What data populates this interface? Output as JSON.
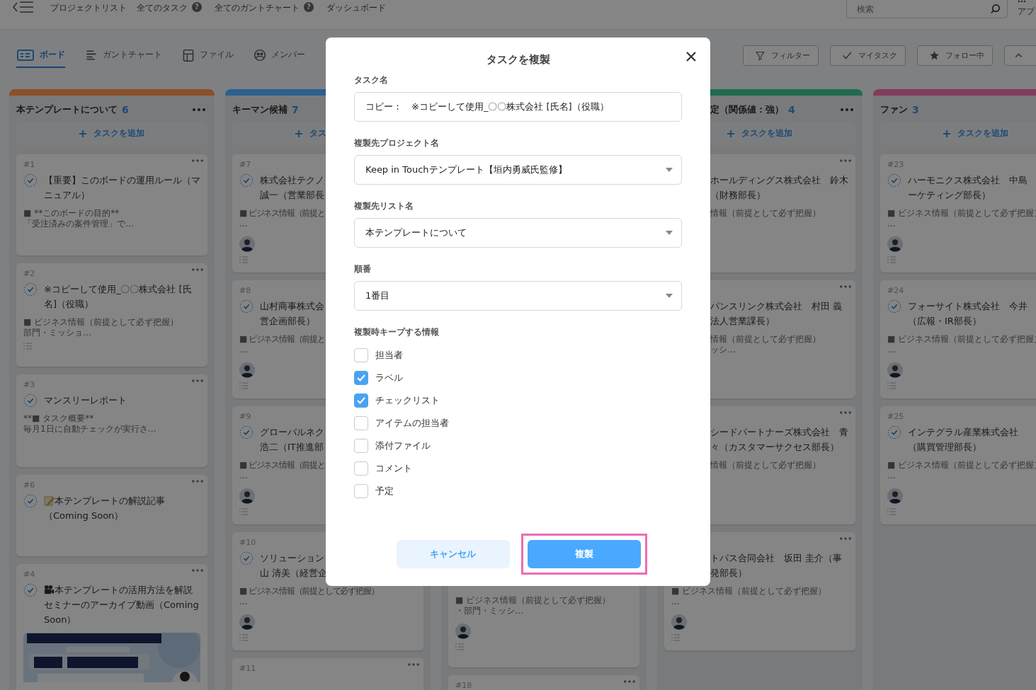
{
  "nav": {
    "items": [
      {
        "label": "プロジェクトリスト"
      },
      {
        "label": "全てのタスク",
        "help": "?"
      },
      {
        "label": "全てのガントチャート",
        "help": "?"
      },
      {
        "label": "ダッシュボード"
      }
    ],
    "search": {
      "placeholder": "検索"
    },
    "apps_label": "アプ"
  },
  "view_tabs": [
    {
      "label": "ボード",
      "selected": true
    },
    {
      "label": "ガントチャート",
      "selected": false
    },
    {
      "label": "ファイル",
      "selected": false
    },
    {
      "label": "メンバー",
      "selected": false
    }
  ],
  "toolbar_buttons": [
    {
      "label": "フィルター"
    },
    {
      "label": "マイタスク"
    },
    {
      "label": "フォロー中"
    },
    {
      "kind": "collapse"
    }
  ],
  "columns": [
    {
      "title": "本テンプレートについて",
      "count": "6",
      "color": "#8c5028",
      "add_label": "タスクを追加",
      "cards": [
        {
          "kind": "task",
          "num": "#1",
          "menu": true,
          "title_lines": [
            "【重要】このボードの運用ルール（マ",
            "ニュアル）"
          ],
          "desc_lines": [
            "■ **このボードの目的**",
            "「受注済みの案件管理」で…"
          ]
        },
        {
          "kind": "task",
          "num": "#2",
          "menu": true,
          "title_lines": [
            "※コピーして使用_〇〇株式会社 [氏",
            "名]（役職）"
          ],
          "desc_lines": [
            "■ ビジネス情報（前提として必ず把握）",
            "部門・ミッショ…"
          ],
          "list": true
        },
        {
          "kind": "task",
          "num": "#3",
          "menu": true,
          "title_lines": [
            "マンスリーレポート"
          ],
          "desc_lines": [
            "**■ タスク概要**",
            "毎月1日に自動チェックが実行さ…"
          ]
        },
        {
          "kind": "memo",
          "num": "#6",
          "menu": true,
          "title_lines": [
            "本テンプレートの解説記事",
            "（Coming Soon）"
          ]
        },
        {
          "kind": "video",
          "num": "#4",
          "menu": true,
          "title_lines": [
            "本テンプレートの活用方法を解説",
            "セミナーのアーカイブ動画（Coming",
            "Soon）"
          ],
          "picture": {
            "kind": "picture"
          }
        }
      ]
    },
    {
      "title": "キーマン候補",
      "count": "7",
      "color": "#2b5f8e",
      "add_label": "タス",
      "cards": [
        {
          "kind": "task",
          "num": "#7",
          "menu": true,
          "title_lines": [
            "株式会社テクノ",
            "誠一（営業部長"
          ],
          "desc_lines": [
            "■ ビジネス情報（前提と",
            "…"
          ],
          "avatar": true,
          "list": true
        },
        {
          "kind": "task",
          "num": "#8",
          "menu": true,
          "title_lines": [
            "山村商事株式会",
            "営企画部長）"
          ],
          "desc_lines": [
            "■ ビジネス情報（前提と",
            "…"
          ],
          "avatar": true,
          "list": true
        },
        {
          "kind": "task",
          "num": "#9",
          "menu": true,
          "title_lines": [
            "グローバルネク",
            "浩二（IT推進部"
          ],
          "desc_lines": [
            "■ ビジネス情報（前提と",
            "…"
          ],
          "avatar": true,
          "list": true
        },
        {
          "kind": "task",
          "num": "#10",
          "menu": true,
          "title_lines": [
            "ソリューション",
            "山 清美（経営企"
          ],
          "desc_lines": [
            "■ ビジネス情報（前提として必ず把握）",
            "…"
          ],
          "avatar": true,
          "list": true
        },
        {
          "kind": "task",
          "num": "#11",
          "menu": true
        }
      ]
    },
    {
      "cards": [
        {
          "kind": "task",
          "desc_lines": [
            "■ ビジネス情報（前提として必ず把握）",
            "・部門・ミッシ…"
          ],
          "avatar": true,
          "list": true
        },
        {
          "kind": "task",
          "num": "#18",
          "menu": true
        }
      ]
    },
    {
      "title": "定（関係値：強）",
      "count": "4",
      "color": "#1f6b4f",
      "add_label": "タスクを追加",
      "cards": [
        {
          "kind": "task",
          "menu": true,
          "title_lines": [
            "ホールディングス株式会社　鈴木",
            "（財務部長）"
          ],
          "desc_lines": [
            "情報（前提として必ず把握）"
          ]
        },
        {
          "kind": "task",
          "menu": true,
          "title_lines": [
            "パンスリンク株式会社　村田 義",
            "法人営業課長）"
          ],
          "desc_lines": [
            "情報（前提として必ず把握）",
            "ッシ…"
          ]
        },
        {
          "kind": "task",
          "menu": true,
          "title_lines": [
            "シードパートナーズ株式会社　青",
            "々（カスタマーサクセス部長）"
          ],
          "desc_lines": [
            "情報（前提として必ず把握）"
          ]
        },
        {
          "kind": "task",
          "menu": true,
          "title_lines": [
            "トパス合同会社　坂田 圭介（事",
            "発部長）"
          ],
          "desc_lines": [
            "■ ビジネス情報（前提として必ず把握）",
            "…"
          ],
          "avatar": true,
          "list": true
        }
      ]
    },
    {
      "title": "ファン",
      "count": "3",
      "color": "#833b5b",
      "add_label": "タスクを追加",
      "cards": [
        {
          "kind": "task",
          "num": "#23",
          "title_lines": [
            "ハーモニクス株式会社　中島",
            "ーケティング部長）"
          ],
          "desc_lines": [
            "■ ビジネス情報（前提として必ず把握）",
            "…"
          ],
          "avatar": true,
          "list": true
        },
        {
          "kind": "task",
          "num": "#24",
          "title_lines": [
            "フォーサイト株式会社　今井",
            "（広報・IR部長）"
          ],
          "desc_lines": [
            "■ ビジネス情報（前提として必ず把握）",
            "…"
          ],
          "avatar": true,
          "list": true
        },
        {
          "kind": "task",
          "num": "#25",
          "title_lines": [
            "インテグラル産業株式会社",
            "（購買管理部長）"
          ],
          "desc_lines": [
            "■ ビジネス情報（前提として必ず把握）",
            "…"
          ],
          "avatar": true,
          "list": true
        }
      ]
    }
  ],
  "dialog": {
    "title": "タスクを複製",
    "fields": [
      {
        "label": "タスク名",
        "kind": "text",
        "value": "コピー：　※コピーして使用_〇〇株式会社 [氏名]（役職）"
      },
      {
        "label": "複製先プロジェクト名",
        "kind": "select",
        "value": "Keep in Touchテンプレート【垣内勇威氏監修】"
      },
      {
        "label": "複製先リスト名",
        "kind": "select",
        "value": "本テンプレートについて"
      },
      {
        "label": "順番",
        "kind": "select",
        "value": "1番目"
      }
    ],
    "keep_label": "複製時キープする情報",
    "keep_options": [
      {
        "label": "担当者",
        "checked": false
      },
      {
        "label": "ラベル",
        "checked": true
      },
      {
        "label": "チェックリスト",
        "checked": true
      },
      {
        "label": "アイテムの担当者",
        "checked": false
      },
      {
        "label": "添付ファイル",
        "checked": false
      },
      {
        "label": "コメント",
        "checked": false
      },
      {
        "label": "予定",
        "checked": false
      }
    ],
    "buttons": [
      {
        "label": "キャンセル",
        "kind": "secondary",
        "highlighted": false
      },
      {
        "label": "複製",
        "kind": "primary",
        "highlighted": true
      }
    ]
  }
}
